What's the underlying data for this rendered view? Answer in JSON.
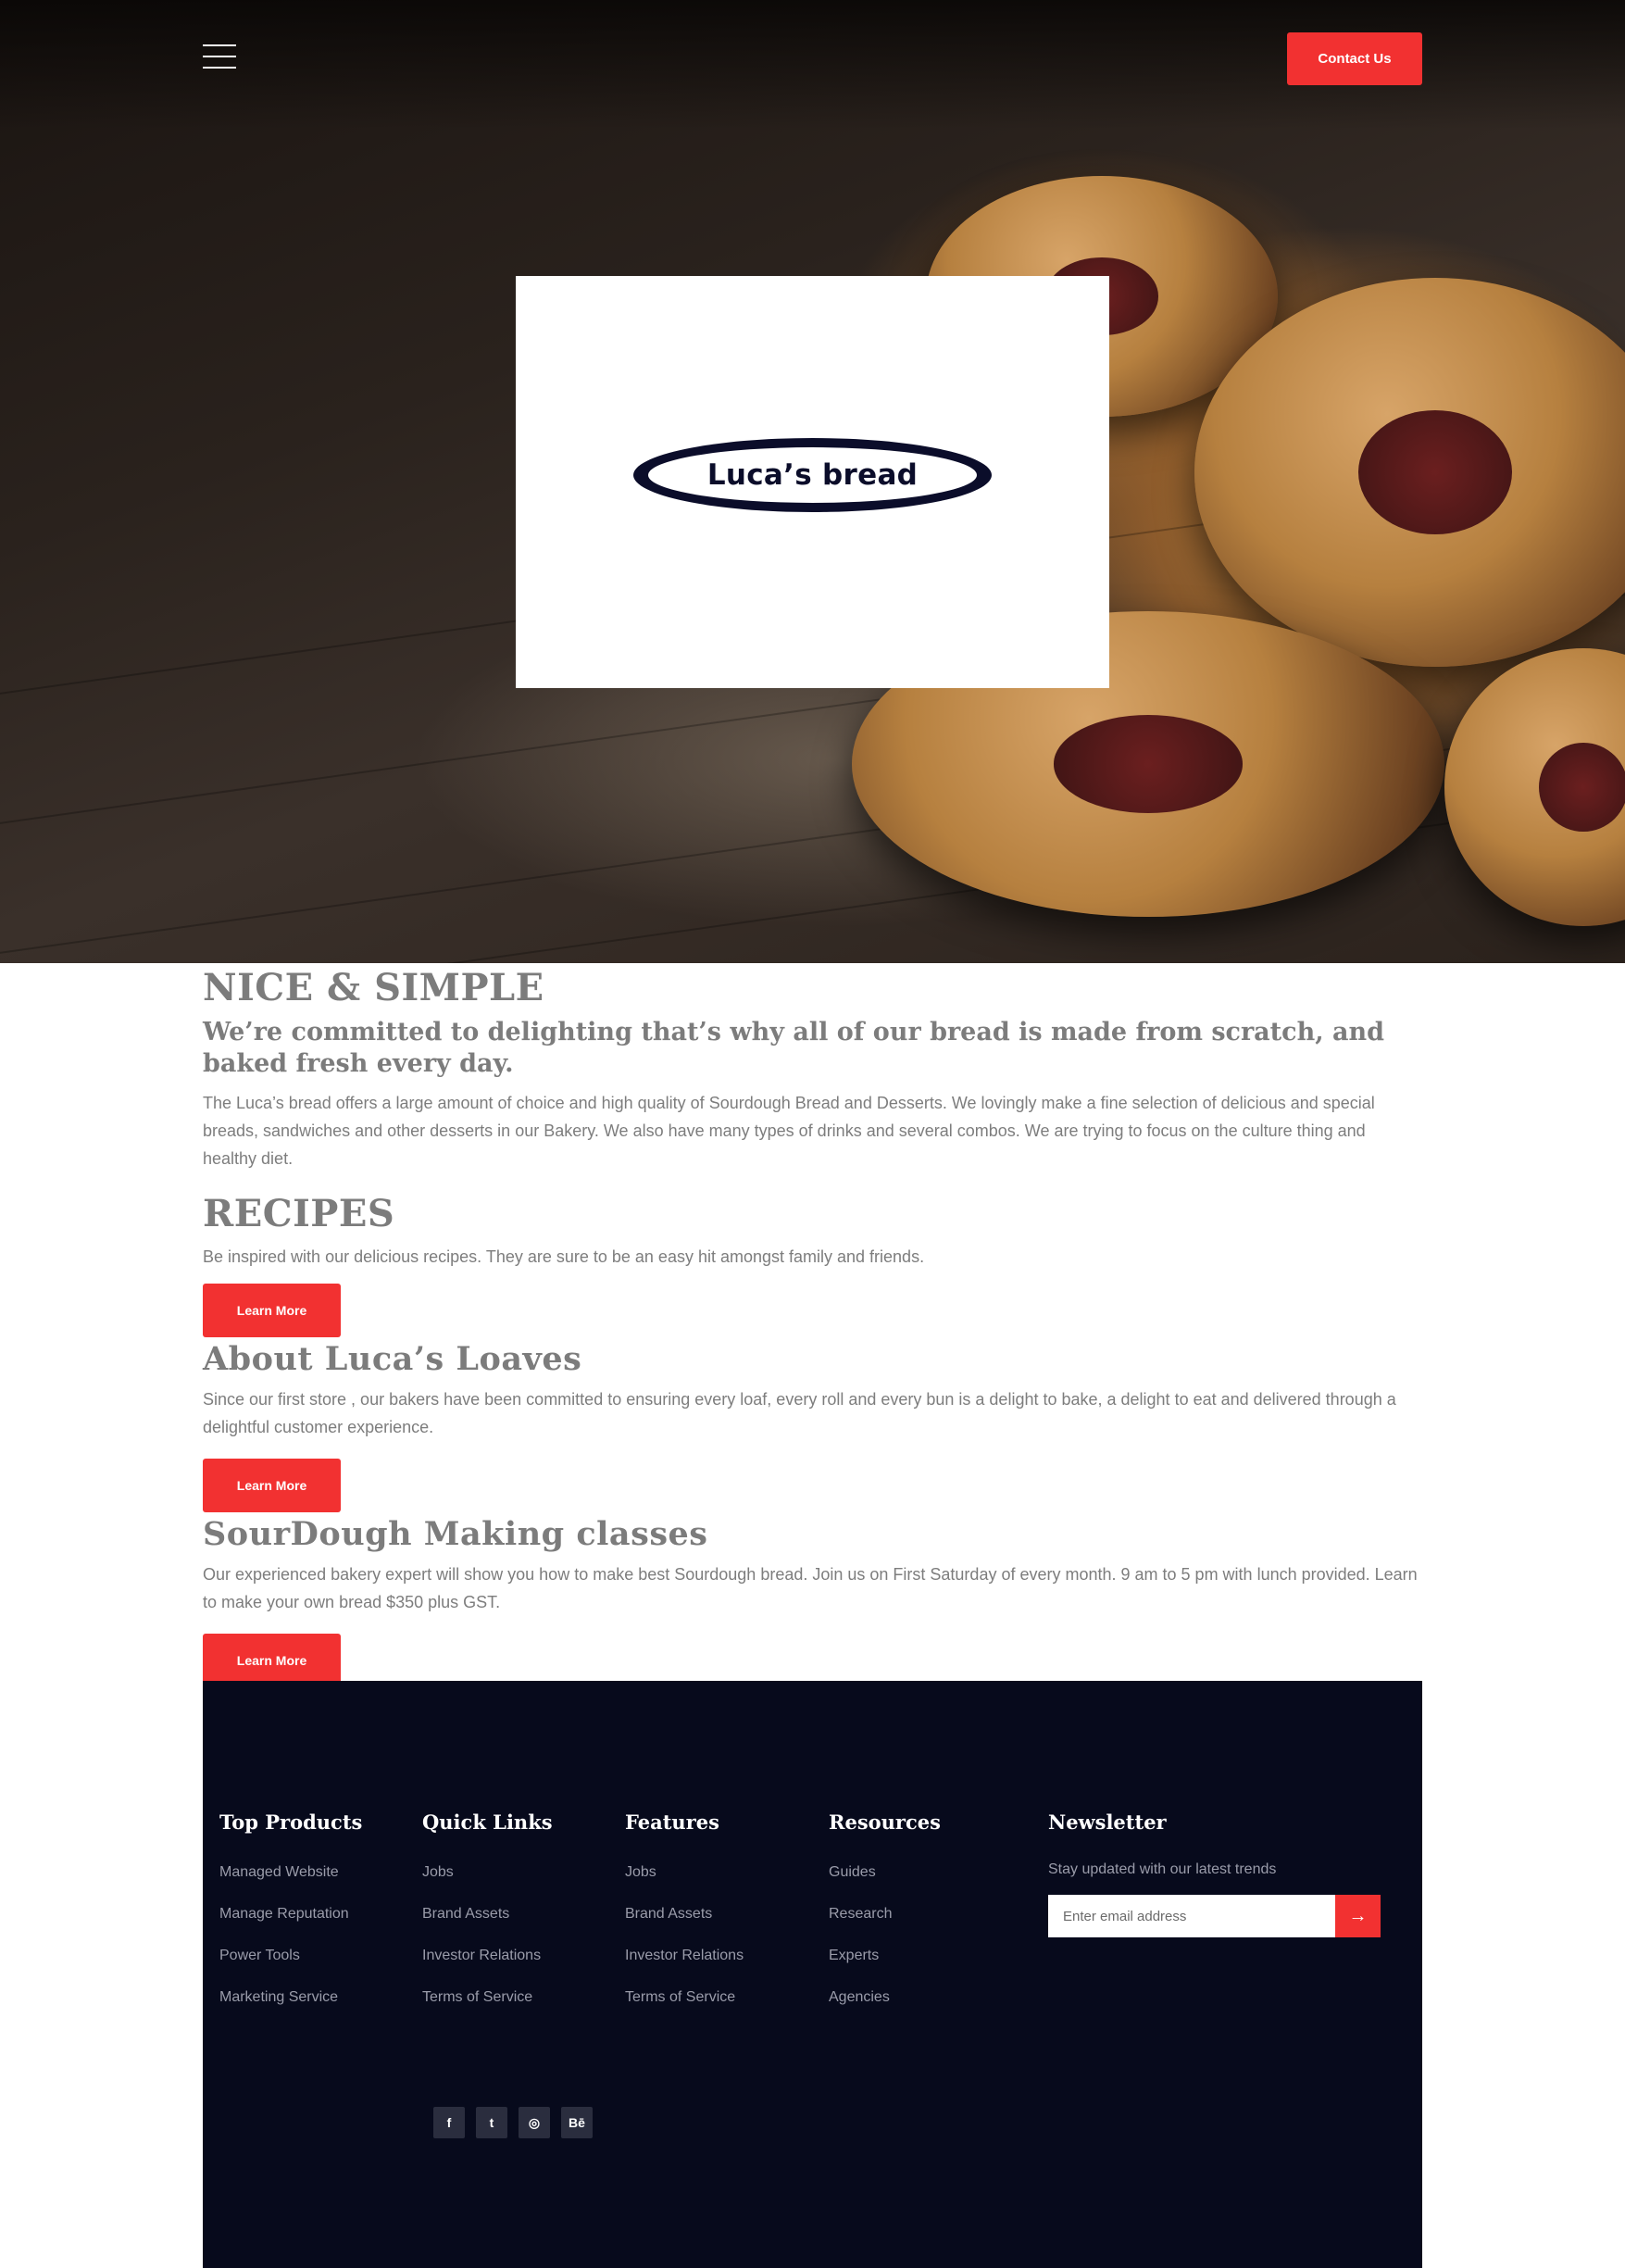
{
  "header": {
    "menu_icon": "hamburger-icon",
    "contact_label": "Contact Us"
  },
  "hero": {
    "logo_text": "Luca’s bread"
  },
  "colors": {
    "accent": "#f23131",
    "footer_bg": "#070a1c",
    "logo_navy": "#0b0d2a"
  },
  "intro": {
    "title": "NICE & SIMPLE",
    "subtitle": "We’re committed to delighting that’s why all of our bread is made from scratch, and baked fresh every day.",
    "body": "The Luca’s bread offers a large amount of choice and high quality of Sourdough Bread and Desserts. We lovingly make a fine selection of delicious and special breads, sandwiches and other desserts in our Bakery. We also have many types of drinks and several combos. We are trying to focus on the culture thing and healthy diet."
  },
  "recipes": {
    "title": "RECIPES",
    "body": "Be inspired with our delicious recipes. They are sure to be an easy hit amongst family and friends.",
    "button": "Learn More"
  },
  "about": {
    "title": "About Luca’s Loaves",
    "body": "Since our first store , our bakers have been committed to ensuring every loaf, every roll and every bun is a delight to bake, a delight to eat and delivered through a delightful customer experience.",
    "button": "Learn More"
  },
  "classes": {
    "title": "SourDough Making classes",
    "body": "Our experienced bakery expert will show you how to make best Sourdough bread. Join us on First Saturday of every month. 9 am to 5 pm with lunch provided. Learn to make your own bread $350 plus GST.",
    "button": "Learn More"
  },
  "footer": {
    "columns": [
      {
        "title": "Top Products",
        "links": [
          "Managed Website",
          "Manage Reputation",
          "Power Tools",
          "Marketing Service"
        ]
      },
      {
        "title": "Quick Links",
        "links": [
          "Jobs",
          "Brand Assets",
          "Investor Relations",
          "Terms of Service"
        ]
      },
      {
        "title": "Features",
        "links": [
          "Jobs",
          "Brand Assets",
          "Investor Relations",
          "Terms of Service"
        ]
      },
      {
        "title": "Resources",
        "links": [
          "Guides",
          "Research",
          "Experts",
          "Agencies"
        ]
      }
    ],
    "newsletter": {
      "title": "Newsletter",
      "description": "Stay updated with our latest trends",
      "placeholder": "Enter email address",
      "submit_icon": "arrow-right-icon"
    },
    "socials": [
      {
        "icon": "facebook-icon",
        "glyph": "f"
      },
      {
        "icon": "twitter-icon",
        "glyph": "t"
      },
      {
        "icon": "dribbble-icon",
        "glyph": "◎"
      },
      {
        "icon": "behance-icon",
        "glyph": "Bē"
      }
    ]
  }
}
